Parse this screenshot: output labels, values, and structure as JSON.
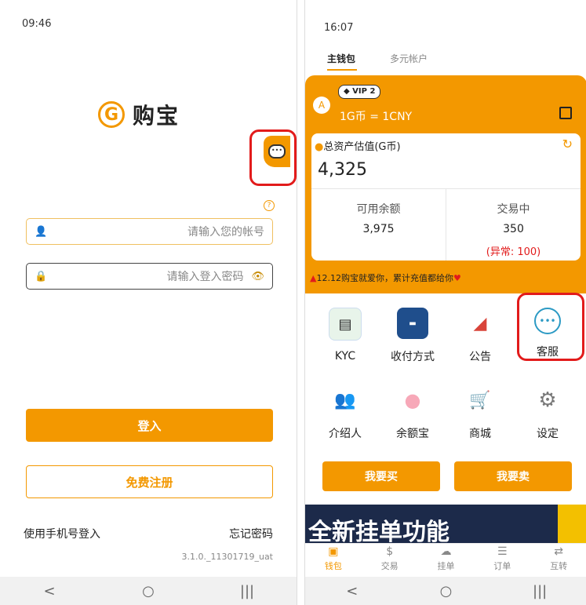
{
  "left": {
    "status_time": "09:46",
    "logo_mark": "G",
    "logo_text": "购宝",
    "help_glyph": "?",
    "username": {
      "placeholder": "请输入您的帐号"
    },
    "password": {
      "placeholder": "请输入登入密码"
    },
    "login_button": "登入",
    "register_button": "免费注册",
    "phone_login_link": "使用手机号登入",
    "forgot_password_link": "忘记密码",
    "version": "3.1.0._11301719_uat",
    "nav": {
      "back": "<",
      "home": "○",
      "recents": "|||"
    },
    "colors": {
      "accent": "#f39800",
      "highlight": "#e21b1b"
    }
  },
  "right": {
    "status_time": "16:07",
    "tabs": [
      "主钱包",
      "多元帐户"
    ],
    "vip_badge": "VIP 2",
    "avatar_letter": "A",
    "rate": "1G币 = 1CNY",
    "total_label": "总资产估值(G币)",
    "total_value": "4,325",
    "available_label": "可用余额",
    "available_value": "3,975",
    "trading_label": "交易中",
    "trading_value": "350",
    "abnormal": "(异常: 100)",
    "notice": "12.12购宝就爱你，累计充值都给你",
    "grid": [
      {
        "label": "KYC",
        "icon": "id-card-icon"
      },
      {
        "label": "收付方式",
        "icon": "unionpay-card-icon"
      },
      {
        "label": "公告",
        "icon": "megaphone-icon"
      },
      {
        "label": "客服",
        "icon": "headset-icon"
      },
      {
        "label": "介绍人",
        "icon": "people-icon"
      },
      {
        "label": "余额宝",
        "icon": "piggy-bank-icon"
      },
      {
        "label": "商城",
        "icon": "shopping-cart-icon"
      },
      {
        "label": "设定",
        "icon": "gear-icon"
      }
    ],
    "buy_button": "我要买",
    "sell_button": "我要卖",
    "banner_text": "全新挂单功能",
    "bottom_nav": [
      "钱包",
      "交易",
      "挂单",
      "订单",
      "互转"
    ],
    "nav": {
      "back": "<",
      "home": "○",
      "recents": "|||"
    }
  }
}
